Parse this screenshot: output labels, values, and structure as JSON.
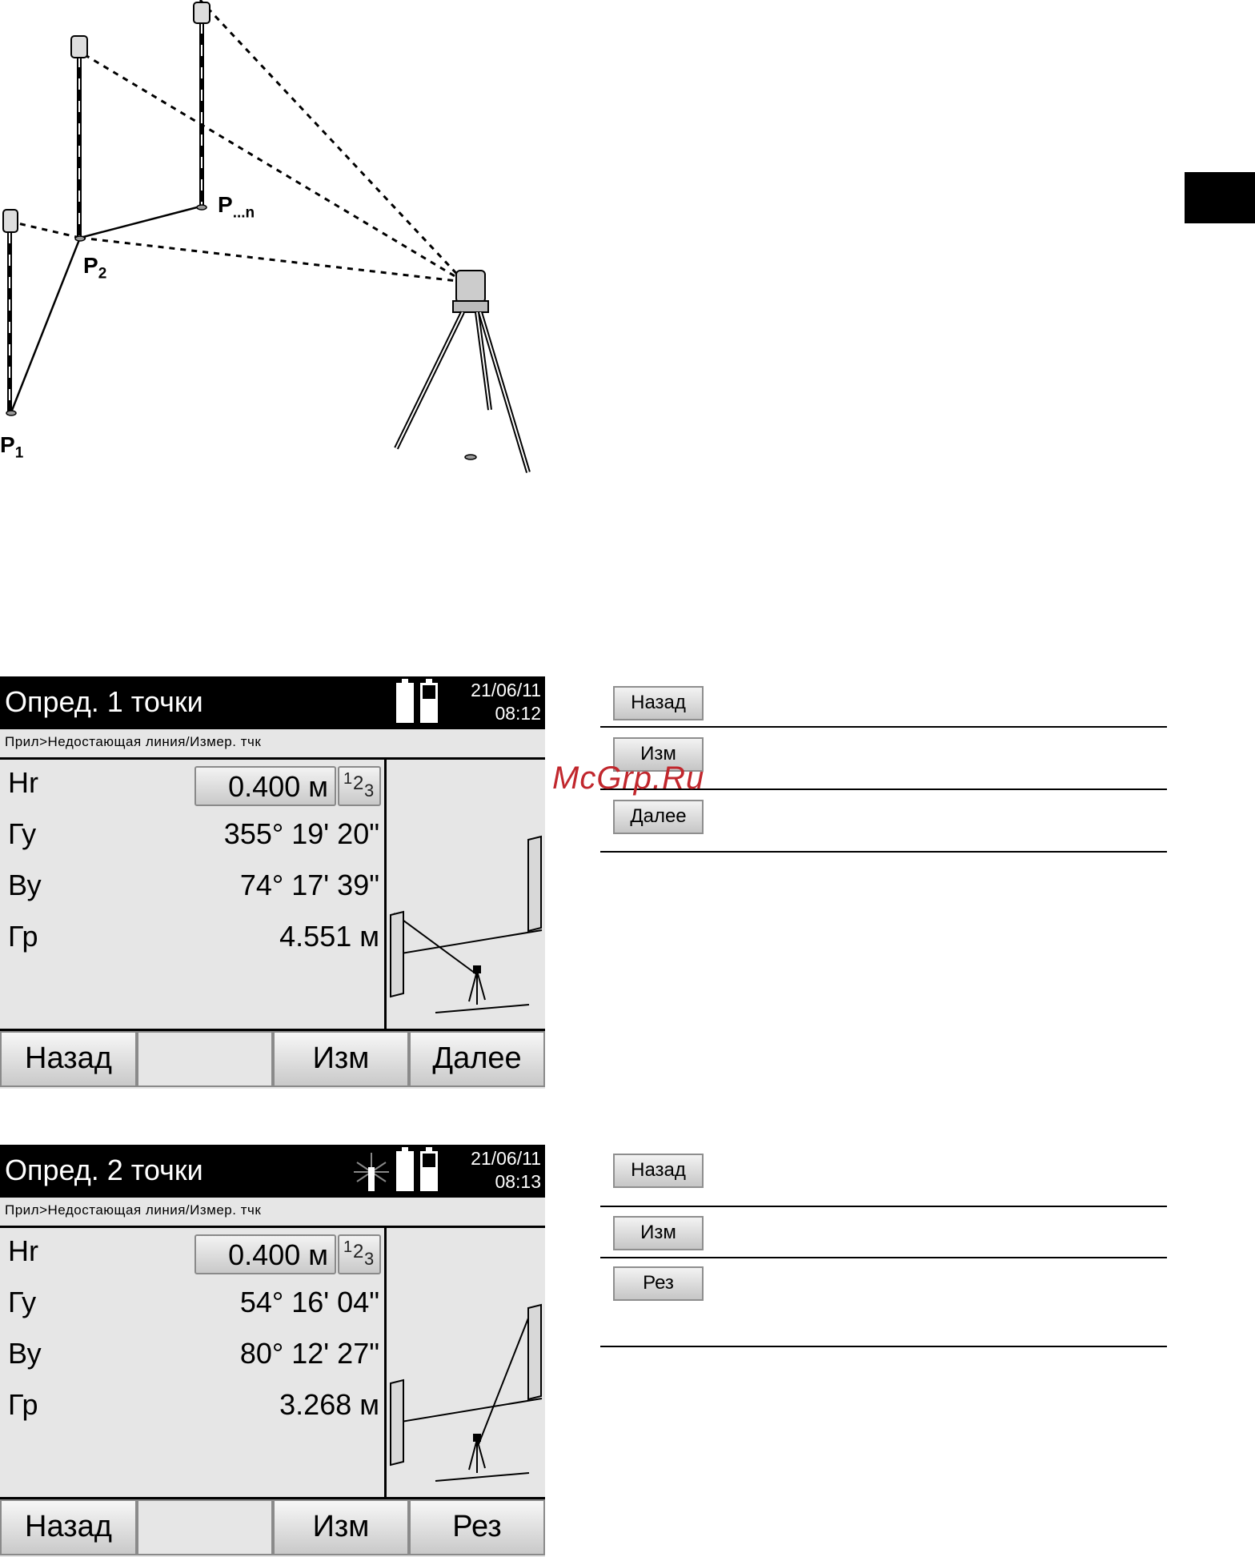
{
  "figure": {
    "label_p1_main": "P",
    "label_p1_sub": "1",
    "label_p2_main": "P",
    "label_p2_sub": "2",
    "label_pn_main": "P",
    "label_pn_sub": "...n"
  },
  "screen1": {
    "title": "Опред. 1 точки",
    "date": "21/06/11",
    "time": "08:12",
    "breadcrumb": "Прил>Недостающая линия/Измер. тчк",
    "rows": [
      {
        "label": "Hr",
        "value": "0.400 м"
      },
      {
        "label": "Гу",
        "value": "355° 19' 20\""
      },
      {
        "label": "Ву",
        "value": "74° 17' 39\""
      },
      {
        "label": "Гр",
        "value": "4.551 м"
      }
    ],
    "num_button": {
      "a": "1",
      "b": "2",
      "c": "3"
    },
    "softkeys": [
      "Назад",
      "",
      "Изм",
      "Далее"
    ]
  },
  "screen2": {
    "title": "Опред. 2 точки",
    "date": "21/06/11",
    "time": "08:13",
    "breadcrumb": "Прил>Недостающая линия/Измер. тчк",
    "rows": [
      {
        "label": "Hr",
        "value": "0.400 м"
      },
      {
        "label": "Гу",
        "value": "54° 16' 04\""
      },
      {
        "label": "Ву",
        "value": "80° 12' 27\""
      },
      {
        "label": "Гр",
        "value": "3.268 м"
      }
    ],
    "num_button": {
      "a": "1",
      "b": "2",
      "c": "3"
    },
    "softkeys": [
      "Назад",
      "",
      "Изм",
      "Рез"
    ]
  },
  "side_buttons_1": [
    "Назад",
    "Изм",
    "Далее"
  ],
  "side_buttons_2": [
    "Назад",
    "Изм",
    "Рез"
  ],
  "watermark": "McGrp.Ru"
}
